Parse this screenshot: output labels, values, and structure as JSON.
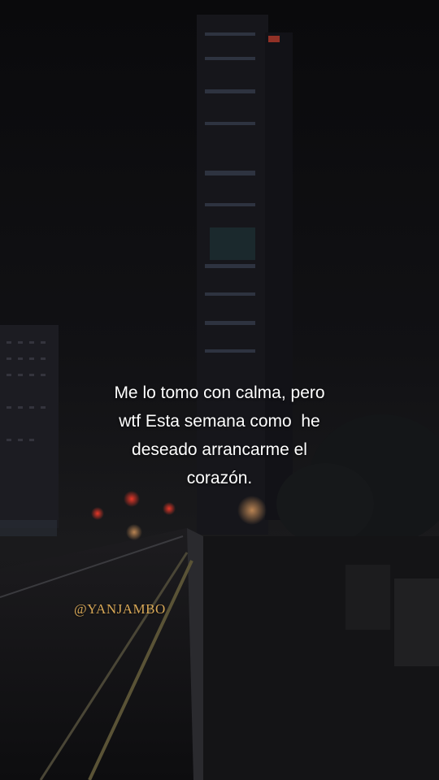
{
  "quote": {
    "lines": [
      "Me lo tomo con calma, pero",
      "wtf Esta semana como  he",
      "deseado arrancarme el",
      "corazón."
    ]
  },
  "watermark": {
    "handle": "@YANJAMBO"
  },
  "colors": {
    "text": "#ffffff",
    "handle": "#d8a857",
    "background": "#0b0b0d"
  }
}
